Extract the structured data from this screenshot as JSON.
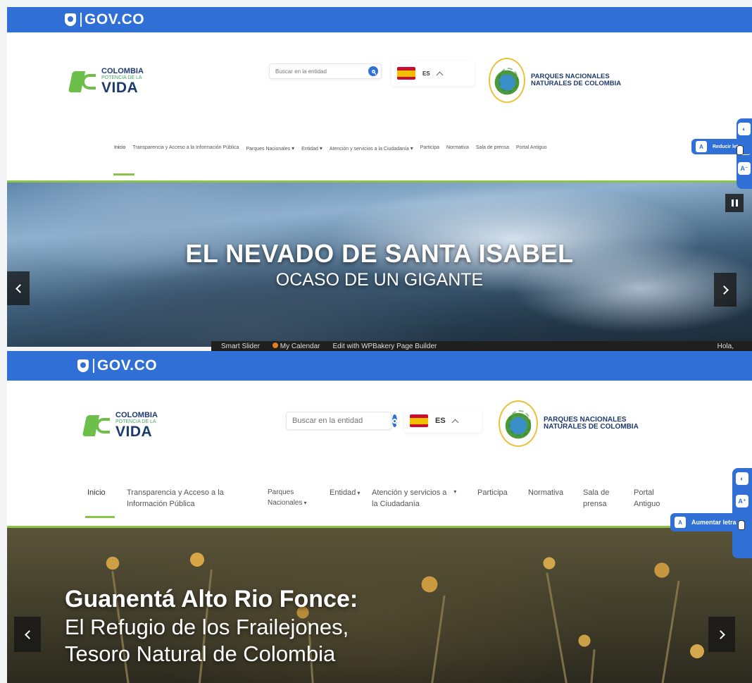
{
  "gov": {
    "label": "GOV.CO"
  },
  "colombia_logo": {
    "line1": "COLOMBIA",
    "line2": "POTENCIA DE LA",
    "line3": "VIDA"
  },
  "parques_logo": {
    "line1": "PARQUES NACIONALES",
    "line2": "NATURALES DE COLOMBIA"
  },
  "search": {
    "placeholder": "Buscar en la entidad"
  },
  "language": {
    "code": "ES"
  },
  "nav_items": {
    "inicio": "Inicio",
    "transparencia_top": "Transparencia y Acceso a la Información Pública",
    "transparencia_l1": "Transparencia y Acceso a la",
    "transparencia_l2": "Información Pública",
    "parques_top": "Parques Nacionales",
    "parques_l1": "Parques",
    "parques_l2": "Nacionales",
    "entidad": "Entidad",
    "atencion_top": "Atención y servicios a la Ciudadanía",
    "atencion_l1": "Atención y servicios a",
    "atencion_l2": "la Ciudadanía",
    "participa": "Participa",
    "normativa": "Normativa",
    "sala_top": "Sala de prensa",
    "sala_l1": "Sala de",
    "sala_l2": "prensa",
    "portal_top": "Portal Antiguo",
    "portal_l1": "Portal",
    "portal_l2": "Antiguo"
  },
  "hero_top": {
    "title": "EL NEVADO DE SANTA ISABEL",
    "subtitle": "OCASO DE UN GIGANTE"
  },
  "hero_bottom": {
    "line1": "Guanentá Alto Rio Fonce:",
    "line2": "El Refugio de los Frailejones,",
    "line3": "Tesoro Natural de Colombia"
  },
  "accessibility": {
    "reduce_label": "Reducir letra",
    "increase_label": "Aumentar letra",
    "btn_a": "A⁺",
    "btn_b": "A⁻"
  },
  "wp_admin_bar": {
    "item1": "Smart Slider",
    "item2": "My Calendar",
    "item3": "Edit with WPBakery Page Builder",
    "greeting": "Hola,"
  },
  "colors": {
    "gov_blue": "#2f6fd6",
    "green": "#8bc34a",
    "dark_blue": "#1d3a6e"
  }
}
